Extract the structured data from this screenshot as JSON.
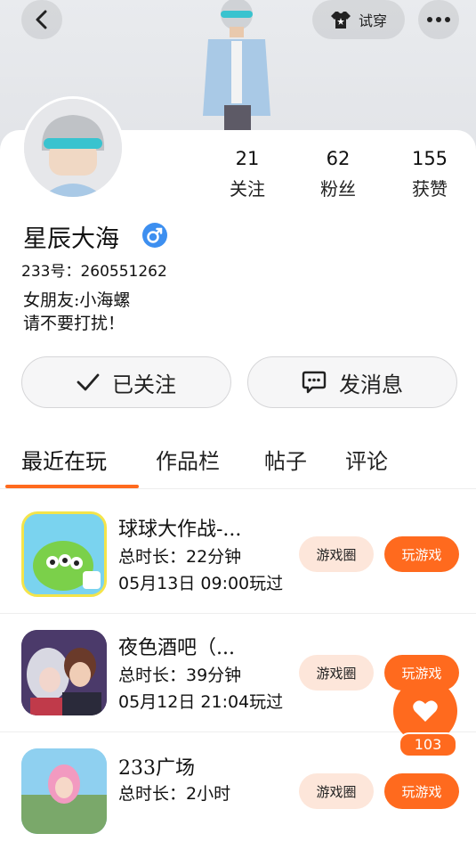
{
  "header": {
    "tryon_label": "试穿",
    "icons": {
      "back": "chevron-left-icon",
      "tryon": "tshirt-icon",
      "more": "more-horizontal-icon"
    }
  },
  "profile": {
    "nickname": "星辰大海",
    "gender_icon": "male-icon",
    "uid": "233号：260551262",
    "bio_line1": "女朋友:小海螺",
    "bio_line2": "请不要打扰！",
    "stats": {
      "following": {
        "value": "21",
        "label": "关注"
      },
      "followers": {
        "value": "62",
        "label": "粉丝"
      },
      "likes": {
        "value": "155",
        "label": "获赞"
      }
    }
  },
  "actions": {
    "follow_label": "已关注",
    "message_label": "发消息"
  },
  "tabs": [
    "最近在玩",
    "作品栏",
    "帖子",
    "评论"
  ],
  "games": [
    {
      "title": "球球大作战-...",
      "duration": "总时长：22分钟",
      "last_played": "05月13日 09:00玩过",
      "circle_label": "游戏圈",
      "play_label": "玩游戏"
    },
    {
      "title": "夜色酒吧（...",
      "duration": "总时长：39分钟",
      "last_played": "05月12日 21:04玩过",
      "circle_label": "游戏圈",
      "play_label": "玩游戏"
    },
    {
      "title": "233广场",
      "duration": "总时长：2小时",
      "circle_label": "游戏圈",
      "play_label": "玩游戏"
    }
  ],
  "like_fab": {
    "count": "103",
    "icon": "heart-icon"
  },
  "colors": {
    "accent": "#ff6a1e",
    "accent_light": "#fde6da",
    "gender_blue": "#3d8ff0"
  }
}
